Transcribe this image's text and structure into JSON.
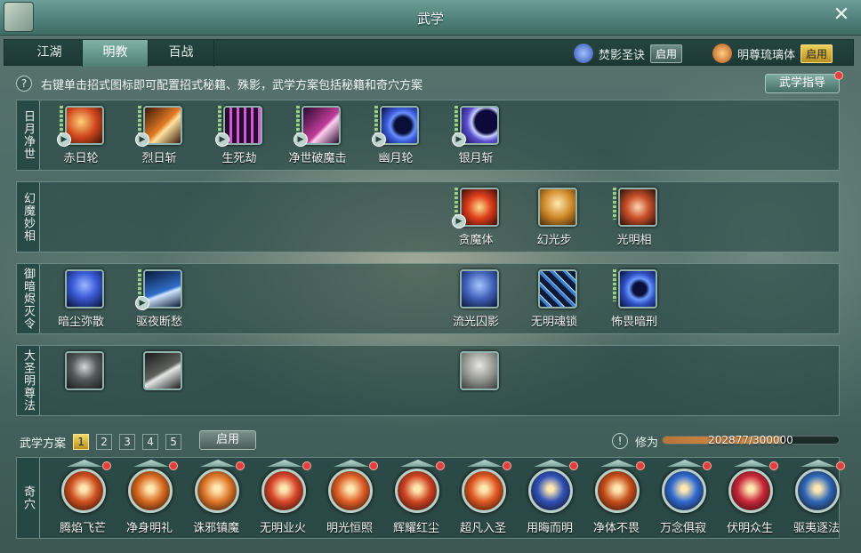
{
  "window": {
    "title": "武学"
  },
  "tabs": [
    {
      "label": "江湖"
    },
    {
      "label": "明教",
      "active": true
    },
    {
      "label": "百战"
    }
  ],
  "stances": [
    {
      "name": "焚影圣诀",
      "button": "启用"
    },
    {
      "name": "明尊琉璃体",
      "button": "启用"
    }
  ],
  "hint": "右键单击招式图标即可配置招式秘籍、殊影，武学方案包括秘籍和奇穴方案",
  "guide_button": "武学指导",
  "rows": [
    {
      "label": "日月净世",
      "skills": [
        {
          "name": "赤日轮",
          "color": "#d0461d"
        },
        {
          "name": "烈日斩",
          "color": "#e07a23"
        },
        {
          "name": "生死劫",
          "color": "#b43ab6"
        },
        {
          "name": "净世破魔击",
          "color": "#c23e9a"
        },
        {
          "name": "幽月轮",
          "color": "#3a58d6"
        },
        {
          "name": "银月斩",
          "color": "#5b4fcf"
        }
      ]
    },
    {
      "label": "幻魔妙相",
      "skills": [
        {
          "name": "贪魔体",
          "color": "#e0401c"
        },
        {
          "name": "幻光步",
          "color": "#d08a2a"
        },
        {
          "name": "光明相",
          "color": "#c8502a"
        }
      ]
    },
    {
      "label": "御暗烬灭令",
      "skills": [
        {
          "name": "暗尘弥散",
          "color": "#3a5ad8"
        },
        {
          "name": "驱夜断愁",
          "color": "#2f6ec8"
        },
        {
          "name": "流光囚影",
          "color": "#3f5fb8"
        },
        {
          "name": "无明魂锁",
          "color": "#3f7fd0"
        },
        {
          "name": "怖畏暗刑",
          "color": "#3050c0"
        }
      ]
    },
    {
      "label": "大圣明尊法",
      "skills": [
        {
          "name": "",
          "color": "#555a5a"
        },
        {
          "name": "",
          "color": "#60625f"
        },
        {
          "name": "",
          "color": "#8d8f8a"
        }
      ]
    }
  ],
  "plan": {
    "label": "武学方案",
    "numbers": [
      "1",
      "2",
      "3",
      "4",
      "5"
    ],
    "selected": "1",
    "apply": "启用"
  },
  "cultivation": {
    "label": "修为",
    "value": "202877/300000",
    "fraction": 0.676
  },
  "qixue": {
    "label": "奇穴",
    "items": [
      {
        "name": "腾焰飞芒",
        "color": "#d0501f"
      },
      {
        "name": "净身明礼",
        "color": "#d86a20"
      },
      {
        "name": "诛邪镇魔",
        "color": "#e0782a"
      },
      {
        "name": "无明业火",
        "color": "#d8462a"
      },
      {
        "name": "明光恒照",
        "color": "#e06028"
      },
      {
        "name": "辉耀红尘",
        "color": "#d04424"
      },
      {
        "name": "超凡入圣",
        "color": "#e05822"
      },
      {
        "name": "用晦而明",
        "color": "#2f52b8"
      },
      {
        "name": "净体不畏",
        "color": "#c8501c"
      },
      {
        "name": "万念俱寂",
        "color": "#2f6ad0"
      },
      {
        "name": "伏明众生",
        "color": "#c8283a"
      },
      {
        "name": "驱夷逐法",
        "color": "#2f68b8"
      }
    ]
  }
}
